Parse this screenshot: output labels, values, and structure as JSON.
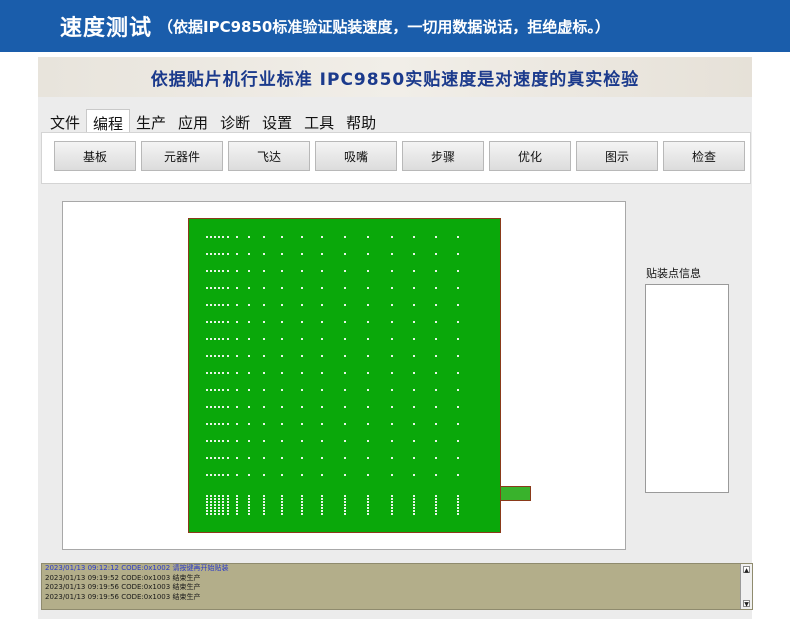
{
  "banner": {
    "title": "速度测试",
    "subtitle": "（依据IPC9850标准验证贴装速度，一切用数据说话，拒绝虚标。）"
  },
  "app": {
    "title": "依据贴片机行业标准 IPC9850实贴速度是对速度的真实检验",
    "menu": [
      "文件",
      "编程",
      "生产",
      "应用",
      "诊断",
      "设置",
      "工具",
      "帮助"
    ],
    "active_menu": "编程",
    "toolbar": [
      "基板",
      "元器件",
      "飞达",
      "吸嘴",
      "步骤",
      "优化",
      "图示",
      "检查"
    ],
    "info_panel_label": "贴装点信息",
    "board_color": "#0aa80a",
    "log_background": "#b3ae8a",
    "log": [
      "2023/01/13 09:12:12  CODE:0x1002  请按键再开始贴装",
      "2023/01/13 09:19:52  CODE:0x1003  结束生产",
      "2023/01/13 09:19:56  CODE:0x1003  结束生产",
      "2023/01/13 09:19:56  CODE:0x1003  结束生产"
    ]
  }
}
